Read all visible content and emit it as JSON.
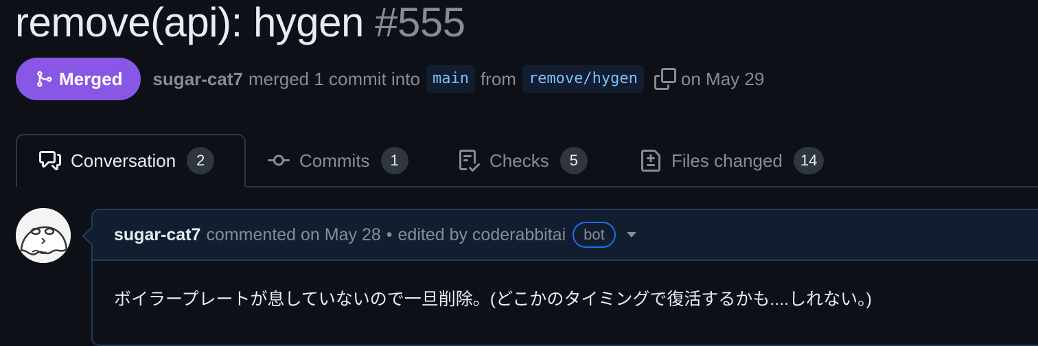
{
  "pr": {
    "title": "remove(api): hygen",
    "number": "#555"
  },
  "status": {
    "label": "Merged",
    "icon": "git-merge-icon",
    "color": "#8957e5"
  },
  "meta": {
    "author": "sugar-cat7",
    "action": "merged 1 commit into",
    "base_branch": "main",
    "from_text": "from",
    "head_branch": "remove/hygen",
    "date_text": "on May 29"
  },
  "tabs": [
    {
      "label": "Conversation",
      "count": "2",
      "icon": "comment-discussion-icon",
      "active": true
    },
    {
      "label": "Commits",
      "count": "1",
      "icon": "git-commit-icon",
      "active": false
    },
    {
      "label": "Checks",
      "count": "5",
      "icon": "checklist-icon",
      "active": false
    },
    {
      "label": "Files changed",
      "count": "14",
      "icon": "file-diff-icon",
      "active": false
    }
  ],
  "comment": {
    "author": "sugar-cat7",
    "action": "commented on May 28",
    "separator": "•",
    "edited_text": "edited by coderabbitai",
    "bot_label": "bot",
    "body": "ボイラープレートが息していないので一旦削除。(どこかのタイミングで復活するかも....しれない。)"
  },
  "colors": {
    "background": "#0d1117",
    "merged": "#8957e5",
    "branch_text": "#79c0ff",
    "muted": "#848d97",
    "border": "#30363d",
    "comment_header": "#121d2f"
  }
}
